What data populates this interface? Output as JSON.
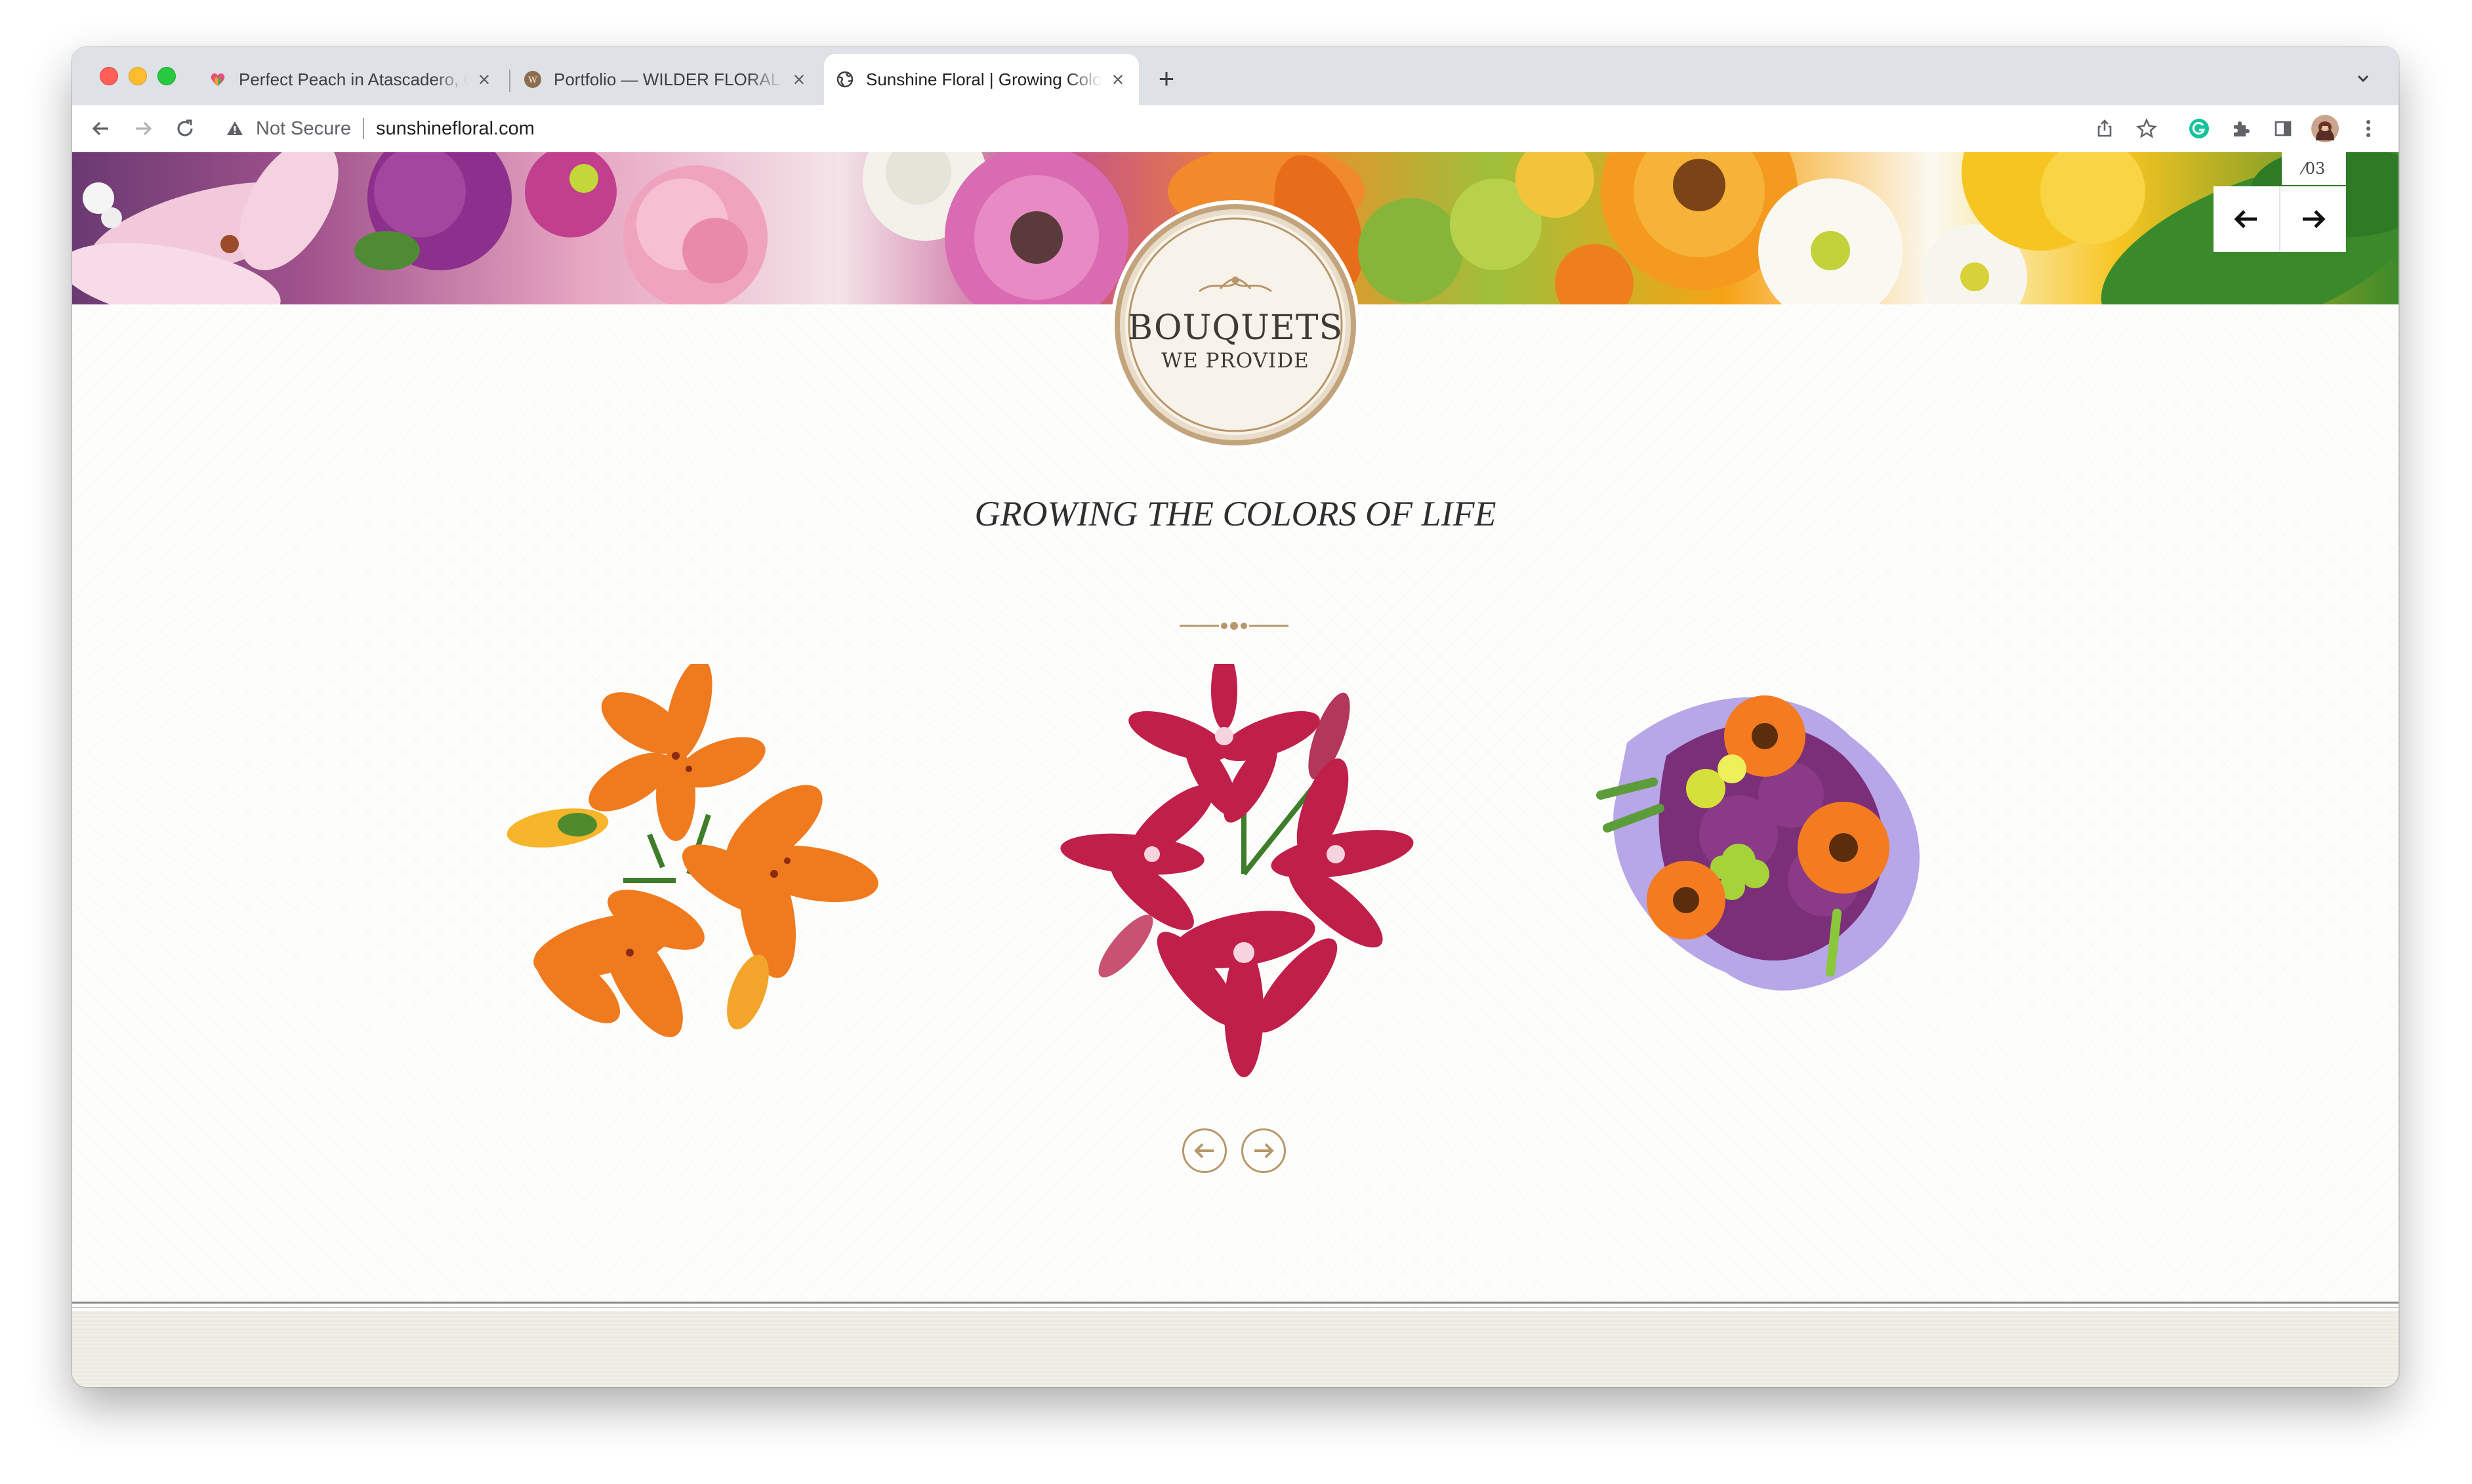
{
  "browser": {
    "tabs": [
      {
        "title": "Perfect Peach in Atascadero, CA",
        "active": false
      },
      {
        "title": "Portfolio — WILDER FLORAL CO",
        "active": false
      },
      {
        "title": "Sunshine Floral | Growing Colors of Life",
        "active": true
      }
    ],
    "close_glyph": "×",
    "new_tab_glyph": "+",
    "security_label": "Not Secure",
    "url": "sunshinefloral.com",
    "accent_colors": {
      "close": "#ff5f57",
      "minimize": "#febc2e",
      "zoom": "#28c840"
    }
  },
  "banner": {
    "slide_counter": "⁄03"
  },
  "seal": {
    "line1": "BOUQUETS",
    "line2": "WE PROVIDE",
    "color": "#b8976b"
  },
  "section": {
    "heading": "GROWING THE COLORS OF LIFE"
  },
  "products": [
    {
      "name": "orange lilies",
      "color": "#f07a1e"
    },
    {
      "name": "red stargazer lilies",
      "color": "#c01f4a"
    },
    {
      "name": "gerbera bouquet",
      "color": "#f47b20"
    }
  ],
  "icons": {
    "back": "arrow-left-icon",
    "forward": "arrow-right-icon",
    "reload": "reload-icon",
    "share": "share-icon",
    "bookmark": "star-icon",
    "grammarly": "grammarly-icon",
    "extensions": "puzzle-icon",
    "sidepanel": "side-panel-icon",
    "menu": "kebab-menu-icon"
  }
}
